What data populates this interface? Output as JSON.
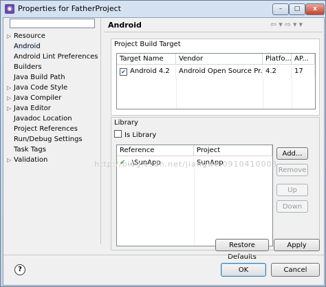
{
  "window": {
    "title": "Properties for FatherProject",
    "minimize_label": "–",
    "maximize_label": "□",
    "close_label": "x"
  },
  "filter": {
    "value": "",
    "placeholder": ""
  },
  "tree": [
    {
      "label": "Resource",
      "expandable": true
    },
    {
      "label": "Android",
      "expandable": false,
      "selected": true
    },
    {
      "label": "Android Lint Preferences",
      "expandable": false
    },
    {
      "label": "Builders",
      "expandable": false
    },
    {
      "label": "Java Build Path",
      "expandable": false
    },
    {
      "label": "Java Code Style",
      "expandable": true
    },
    {
      "label": "Java Compiler",
      "expandable": true
    },
    {
      "label": "Java Editor",
      "expandable": true
    },
    {
      "label": "Javadoc Location",
      "expandable": false
    },
    {
      "label": "Project References",
      "expandable": false
    },
    {
      "label": "Run/Debug Settings",
      "expandable": false
    },
    {
      "label": "Task Tags",
      "expandable": false
    },
    {
      "label": "Validation",
      "expandable": true
    }
  ],
  "page": {
    "title": "Android",
    "nav_icons": [
      "back-arrow-icon",
      "forward-arrow-icon",
      "view-menu-icon"
    ]
  },
  "build_target": {
    "label": "Project Build Target",
    "columns": [
      "Target Name",
      "Vendor",
      "Platfo...",
      "AP..."
    ],
    "rows": [
      {
        "checked": true,
        "name": "Android 4.2",
        "vendor": "Android Open Source Pr...",
        "platform": "4.2",
        "api": "17"
      }
    ]
  },
  "library": {
    "label": "Library",
    "is_library_label": "Is Library",
    "is_library_checked": false,
    "columns": [
      "Reference",
      "Project"
    ],
    "rows": [
      {
        "reference": "..\\SunApp",
        "project": "SunApp",
        "status_icon": "check-icon"
      }
    ],
    "buttons": {
      "add": "Add...",
      "remove": "Remove",
      "up": "Up",
      "down": "Down"
    }
  },
  "watermark": "http://blog.csdn.net/jiangwei0910410003",
  "footer": {
    "restore_defaults": "Restore Defaults",
    "apply": "Apply",
    "ok": "OK",
    "cancel": "Cancel",
    "help_label": "?"
  }
}
